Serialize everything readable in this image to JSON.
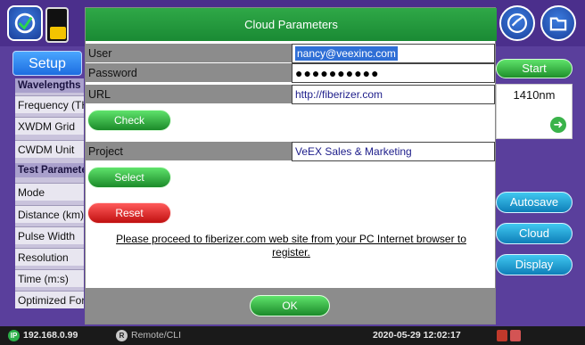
{
  "dialog": {
    "title": "Cloud Parameters",
    "fields": [
      {
        "label": "User",
        "value": "nancy@veexinc.com"
      },
      {
        "label": "Password",
        "value": "●●●●●●●●●●"
      },
      {
        "label": "URL",
        "value": "http://fiberizer.com"
      },
      {
        "label": "Project",
        "value": "VeEX Sales & Marketing"
      }
    ],
    "check_label": "Check",
    "select_label": "Select",
    "reset_label": "Reset",
    "notice": "Please proceed to fiberizer.com web site from your PC Internet browser to register.",
    "ok_label": "OK"
  },
  "background": {
    "setup_tab": "Setup",
    "sidebar": {
      "sections": [
        {
          "heading": "Wavelengths",
          "items": [
            "Frequency (THz)",
            "XWDM Grid",
            "CWDM Unit"
          ]
        },
        {
          "heading": "Test Parameters",
          "items": [
            "Mode",
            "Distance (km)",
            "Pulse Width",
            "Resolution",
            "Time (m:s)",
            "Optimized For"
          ]
        }
      ]
    },
    "right_buttons": {
      "start": "Start",
      "autosave": "Autosave",
      "cloud": "Cloud",
      "display": "Display"
    },
    "wavelength": "1410nm"
  },
  "statusbar": {
    "ip_icon": "IP",
    "ip": "192.168.0.99",
    "remote_icon": "R",
    "remote": "Remote/CLI",
    "datetime": "2020-05-29 12:02:17"
  },
  "colors": {
    "title_bar": "#2fa847",
    "label_bg": "#8c8c8c",
    "background": "#5a3f9c",
    "reset": "#e02020"
  }
}
